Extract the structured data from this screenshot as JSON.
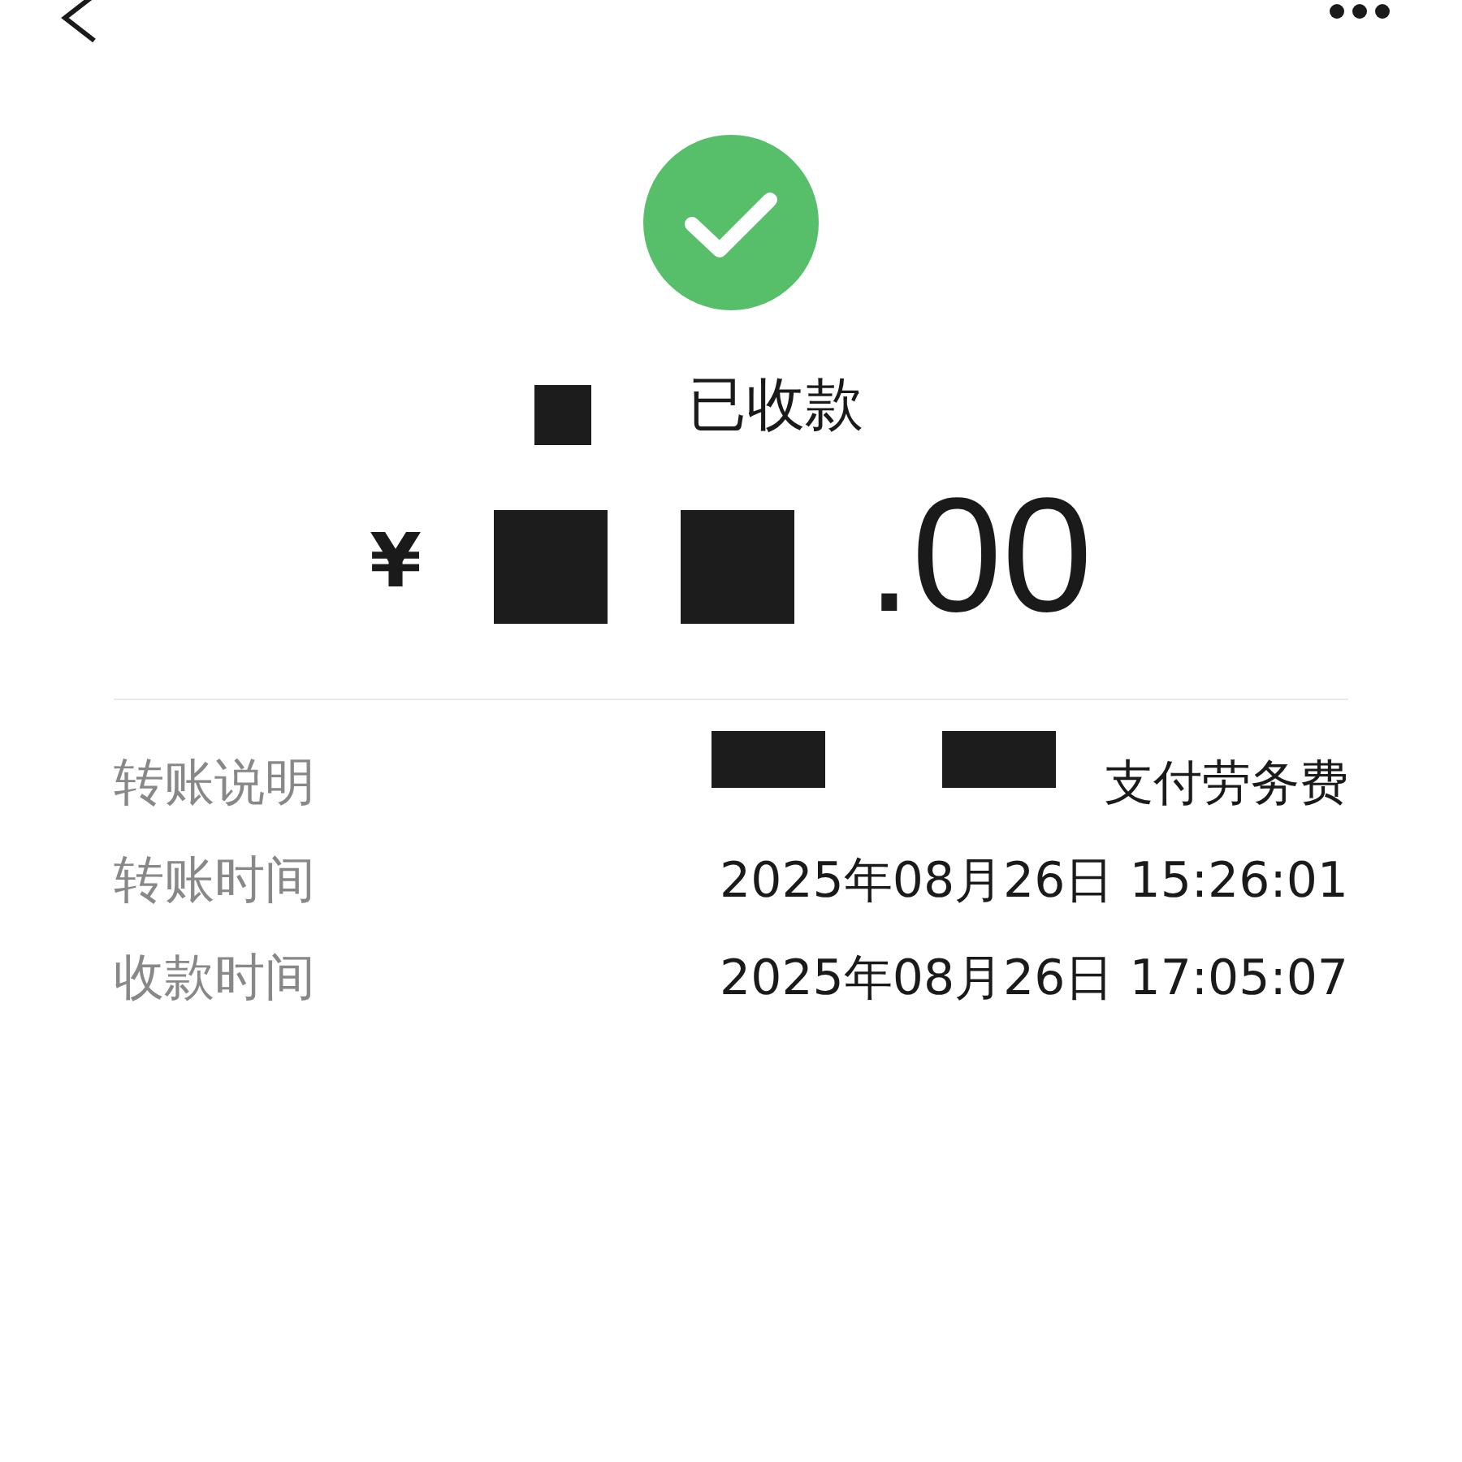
{
  "status": {
    "text": "已收款",
    "kind": "received"
  },
  "amount": {
    "currency": "¥",
    "decimals": ".00"
  },
  "details": [
    {
      "label": "转账说明",
      "value": "支付劳务费",
      "redacted": true
    },
    {
      "label": "转账时间",
      "value": "2025年08月26日 15:26:01",
      "redacted": false
    },
    {
      "label": "收款时间",
      "value": "2025年08月26日 17:05:07",
      "redacted": false
    }
  ]
}
